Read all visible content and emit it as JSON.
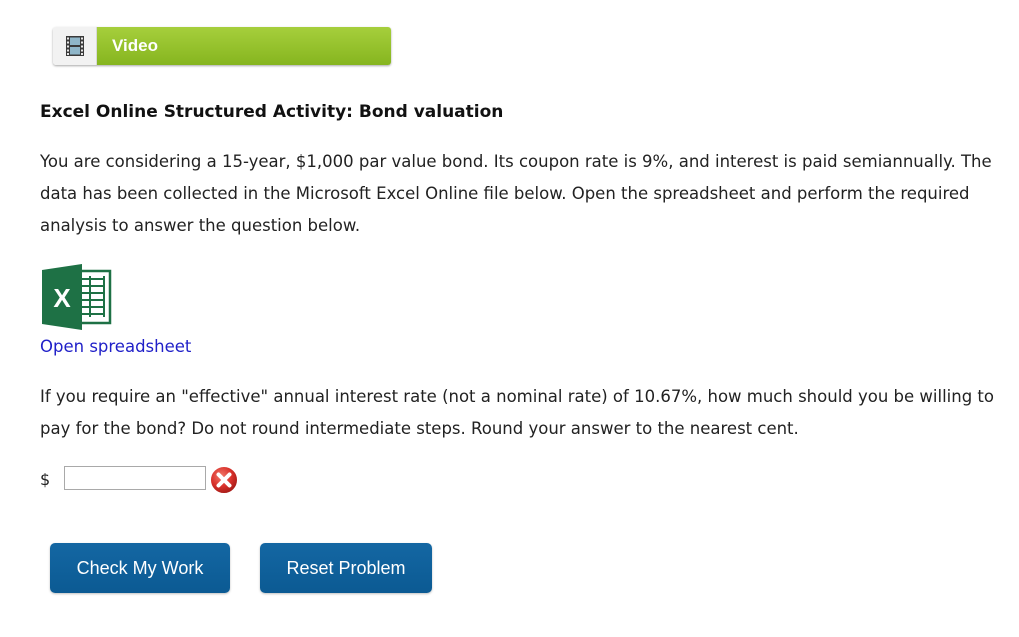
{
  "video_tab": {
    "label": "Video",
    "icon": "film-icon"
  },
  "activity": {
    "title": "Excel Online Structured Activity: Bond valuation",
    "intro": "You are considering a 15-year, $1,000 par value bond. Its coupon rate is 9%, and interest is paid semiannually. The data has been collected in the Microsoft Excel Online file below. Open the spreadsheet and perform the required analysis to answer the question below.",
    "excel_icon": "excel-icon",
    "open_link": "Open spreadsheet",
    "question": "If you require an \"effective\" annual interest rate (not a nominal rate) of 10.67%, how much should you be willing to pay for the bond? Do not round intermediate steps. Round your answer to the nearest cent."
  },
  "answer": {
    "currency": "$",
    "value": "",
    "status_icon": "error-x-icon"
  },
  "buttons": {
    "check": "Check My Work",
    "reset": "Reset Problem"
  },
  "colors": {
    "video_green": "#95c22b",
    "button_blue": "#0f5f9a",
    "link_blue": "#1f1fc8",
    "excel_green": "#1e7145",
    "error_red": "#d9312b"
  }
}
